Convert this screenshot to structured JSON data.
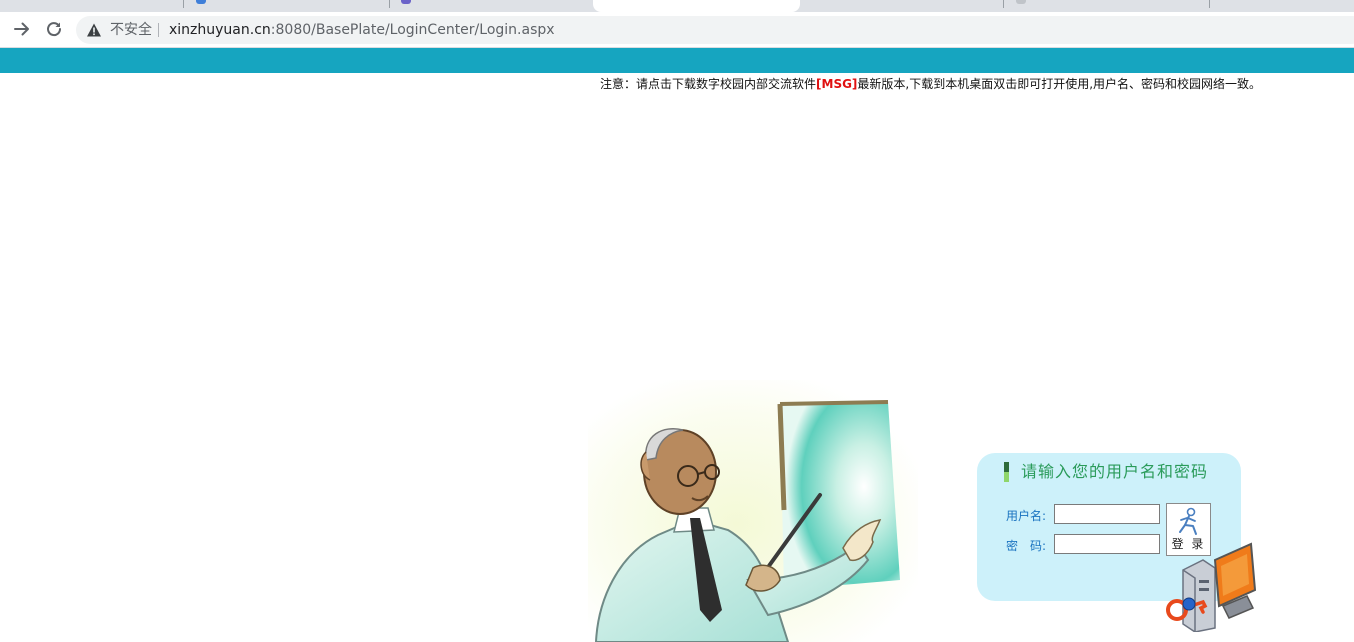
{
  "browser": {
    "security_text": "不安全",
    "url_host": "xinzhuyuan.cn",
    "url_rest": ":8080/BasePlate/LoginCenter/Login.aspx"
  },
  "notice": {
    "prefix": "注意：请点击下载数字校园内部交流软件",
    "link": "[MSG]",
    "suffix": "最新版本,下载到本机桌面双击即可打开使用,用户名、密码和校园网络一致。"
  },
  "login": {
    "title": "请输入您的用户名和密码",
    "username_label": "用户名:",
    "password_label": "密　码:",
    "username_value": "",
    "password_value": "",
    "button_label": "登 录"
  },
  "colors": {
    "topbar": "#16a5c0",
    "panel": "#cdf1fa",
    "title": "#2a9b5a",
    "label": "#1a73c0",
    "msg": "#e01010"
  }
}
